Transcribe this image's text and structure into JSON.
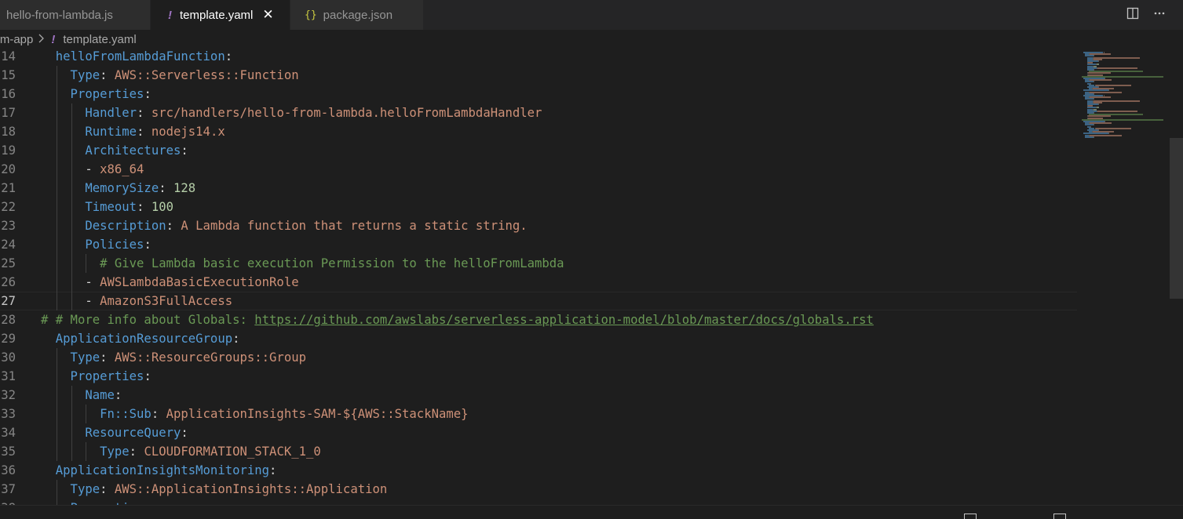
{
  "tabs": [
    {
      "label": "hello-from-lambda.js"
    },
    {
      "icon": "!",
      "label": "template.yaml",
      "close": "✕"
    },
    {
      "icon": "{}",
      "label": "package.json"
    }
  ],
  "breadcrumb": {
    "folder": "sam-app",
    "file_icon": "!",
    "file": "template.yaml"
  },
  "editor": {
    "lines": [
      {
        "num": "14",
        "parts": [
          [
            "k",
            "  helloFromLambdaFunction"
          ],
          [
            "p",
            ":"
          ]
        ]
      },
      {
        "num": "15",
        "parts": [
          [
            "k",
            "    Type"
          ],
          [
            "p",
            ": "
          ],
          [
            "s",
            "AWS::Serverless::Function"
          ]
        ]
      },
      {
        "num": "16",
        "parts": [
          [
            "k",
            "    Properties"
          ],
          [
            "p",
            ":"
          ]
        ]
      },
      {
        "num": "17",
        "parts": [
          [
            "k",
            "      Handler"
          ],
          [
            "p",
            ": "
          ],
          [
            "s",
            "src/handlers/hello-from-lambda.helloFromLambdaHandler"
          ]
        ]
      },
      {
        "num": "18",
        "parts": [
          [
            "k",
            "      Runtime"
          ],
          [
            "p",
            ": "
          ],
          [
            "s",
            "nodejs14.x"
          ]
        ]
      },
      {
        "num": "19",
        "parts": [
          [
            "k",
            "      Architectures"
          ],
          [
            "p",
            ":"
          ]
        ]
      },
      {
        "num": "20",
        "parts": [
          [
            "p",
            "      - "
          ],
          [
            "s",
            "x86_64"
          ]
        ]
      },
      {
        "num": "21",
        "parts": [
          [
            "k",
            "      MemorySize"
          ],
          [
            "p",
            ": "
          ],
          [
            "n",
            "128"
          ]
        ]
      },
      {
        "num": "22",
        "parts": [
          [
            "k",
            "      Timeout"
          ],
          [
            "p",
            ": "
          ],
          [
            "n",
            "100"
          ]
        ]
      },
      {
        "num": "23",
        "parts": [
          [
            "k",
            "      Description"
          ],
          [
            "p",
            ": "
          ],
          [
            "s",
            "A Lambda function that returns a static string."
          ]
        ]
      },
      {
        "num": "24",
        "parts": [
          [
            "k",
            "      Policies"
          ],
          [
            "p",
            ":"
          ]
        ]
      },
      {
        "num": "25",
        "parts": [
          [
            "c",
            "        # Give Lambda basic execution Permission to the helloFromLambda"
          ]
        ]
      },
      {
        "num": "26",
        "parts": [
          [
            "p",
            "      - "
          ],
          [
            "s",
            "AWSLambdaBasicExecutionRole"
          ]
        ]
      },
      {
        "num": "27",
        "current": true,
        "parts": [
          [
            "p",
            "      - "
          ],
          [
            "s",
            "AmazonS3FullAccess"
          ]
        ]
      },
      {
        "num": "28",
        "parts": [
          [
            "c",
            "# # More info about Globals: "
          ],
          [
            "u",
            "https://github.com/awslabs/serverless-application-model/blob/master/docs/globals.rst"
          ]
        ]
      },
      {
        "num": "29",
        "parts": [
          [
            "k",
            "  ApplicationResourceGroup"
          ],
          [
            "p",
            ":"
          ]
        ]
      },
      {
        "num": "30",
        "parts": [
          [
            "k",
            "    Type"
          ],
          [
            "p",
            ": "
          ],
          [
            "s",
            "AWS::ResourceGroups::Group"
          ]
        ]
      },
      {
        "num": "31",
        "parts": [
          [
            "k",
            "    Properties"
          ],
          [
            "p",
            ":"
          ]
        ]
      },
      {
        "num": "32",
        "parts": [
          [
            "k",
            "      Name"
          ],
          [
            "p",
            ":"
          ]
        ]
      },
      {
        "num": "33",
        "parts": [
          [
            "k",
            "        Fn::Sub"
          ],
          [
            "p",
            ": "
          ],
          [
            "s",
            "ApplicationInsights-SAM-${AWS::StackName}"
          ]
        ]
      },
      {
        "num": "34",
        "parts": [
          [
            "k",
            "      ResourceQuery"
          ],
          [
            "p",
            ":"
          ]
        ]
      },
      {
        "num": "35",
        "parts": [
          [
            "k",
            "        Type"
          ],
          [
            "p",
            ": "
          ],
          [
            "s",
            "CLOUDFORMATION_STACK_1_0"
          ]
        ]
      },
      {
        "num": "36",
        "parts": [
          [
            "k",
            "  ApplicationInsightsMonitoring"
          ],
          [
            "p",
            ":"
          ]
        ]
      },
      {
        "num": "37",
        "parts": [
          [
            "k",
            "    Type"
          ],
          [
            "p",
            ": "
          ],
          [
            "s",
            "AWS::ApplicationInsights::Application"
          ]
        ]
      },
      {
        "num": "38",
        "parts": [
          [
            "k",
            "    Properties"
          ],
          [
            "p",
            ":"
          ]
        ]
      }
    ]
  },
  "icons": {
    "split_editor": "split-editor-icon",
    "more_actions": "more-actions-icon"
  },
  "colors": {
    "keyword": "#569cd6",
    "string": "#ce9178",
    "number": "#b5cea8",
    "comment": "#6a9955",
    "yaml_icon": "#a074c4",
    "json_icon": "#cbcb41"
  }
}
